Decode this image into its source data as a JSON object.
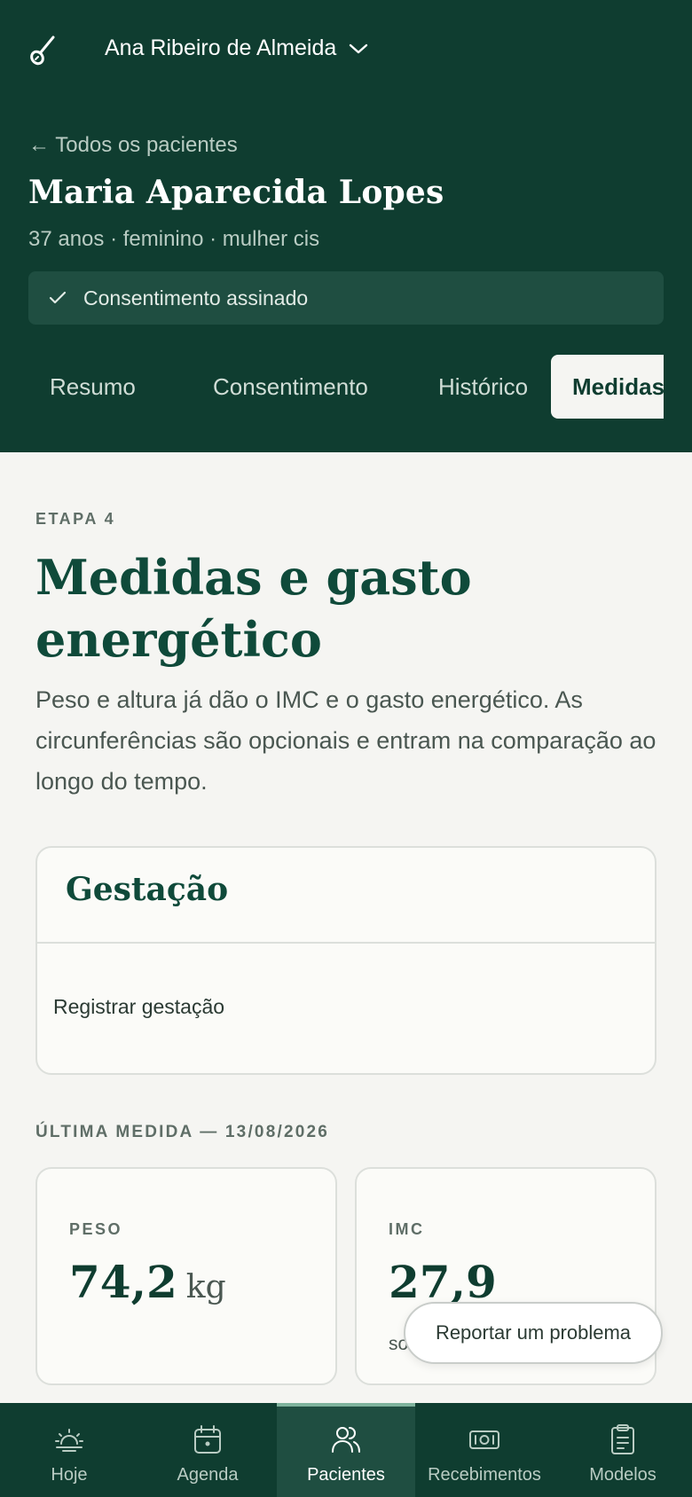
{
  "app": {
    "user_name": "Ana Ribeiro de Almeida",
    "logo_icon": "spoon-logo-icon"
  },
  "patient": {
    "back_link": "← Todos os pacientes",
    "name": "Maria Aparecida Lopes",
    "meta": "37 anos · feminino · mulher cis",
    "consent_status": "Consentimento assinado"
  },
  "tabs": [
    {
      "label": "Resumo",
      "active": false
    },
    {
      "label": "Consentimento",
      "active": false
    },
    {
      "label": "Histórico",
      "active": false
    },
    {
      "label": "Medidas",
      "active": true
    }
  ],
  "page": {
    "eyebrow": "ETAPA 4",
    "title": "Medidas e gasto energético",
    "lead": "Peso e altura já dão o IMC e o gasto energético. As circunferências são opcionais e entram na comparação ao longo do tempo."
  },
  "gestation": {
    "title": "Gestação",
    "action": "Registrar gestação"
  },
  "last_measure": {
    "label": "ÚLTIMA MEDIDA — 13/08/2026",
    "peso": {
      "label": "PESO",
      "value": "74,2",
      "unit": "kg"
    },
    "imc": {
      "label": "IMC",
      "value": "27,9",
      "note": "so"
    }
  },
  "report_button": "Reportar um problema",
  "bottom_nav": [
    {
      "label": "Hoje",
      "icon": "sunrise-icon",
      "active": false
    },
    {
      "label": "Agenda",
      "icon": "calendar-icon",
      "active": false
    },
    {
      "label": "Pacientes",
      "icon": "users-icon",
      "active": true
    },
    {
      "label": "Recebimentos",
      "icon": "banknote-icon",
      "active": false
    },
    {
      "label": "Modelos",
      "icon": "clipboard-icon",
      "active": false
    }
  ],
  "colors": {
    "primary_dark": "#0f3d30",
    "heading_green": "#0f4a3a",
    "background": "#f5f5f2"
  }
}
